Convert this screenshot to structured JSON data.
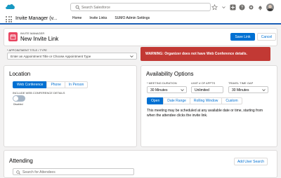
{
  "global": {
    "search_placeholder": "Search Salesforce"
  },
  "nav": {
    "app_name": "Invite Manager (v...",
    "items": [
      {
        "label": "Home"
      },
      {
        "label": "Invite Links"
      },
      {
        "label": "SUMO Admin Settings"
      }
    ]
  },
  "header": {
    "subtitle": "INVITE MANAGER",
    "title": "New Invite Link",
    "save_label": "Save Link",
    "cancel_label": "Cancel"
  },
  "appointment": {
    "label": "* APPOINTMENT TITLE / TYPE",
    "placeholder": "Enter an Appointment Title or Choose Appointment Type"
  },
  "warning": {
    "text": "WARNING: Organizer does not have Web Conference details."
  },
  "location": {
    "title": "Location",
    "tabs": [
      {
        "label": "Web Conference"
      },
      {
        "label": "Phone"
      },
      {
        "label": "In Person"
      }
    ],
    "include_label": "INCLUDE WEB CONFERENCE DETAILS",
    "toggle_state": "Disabled"
  },
  "availability": {
    "title": "Availability Options",
    "meeting_duration_label": "* MEETING DURATION",
    "meeting_duration_value": "30 Minutes",
    "limit_label": "LIMIT # OF APPTS",
    "limit_value": "Unlimited",
    "travel_label": "TRAVEL TIME GAP",
    "travel_value": "30 Minutes",
    "tabs": [
      {
        "label": "Open"
      },
      {
        "label": "Date Range"
      },
      {
        "label": "Rolling Window"
      },
      {
        "label": "Custom"
      }
    ],
    "description": "This meeting may be scheduled at any available date or time, starting from when the attendee clicks the invite link."
  },
  "attending": {
    "title": "Attending",
    "add_user_label": "Add User Search",
    "search_placeholder": "Search for Attendees"
  },
  "colors": {
    "brand": "#0070d2",
    "warning": "#c23934",
    "record_icon": "#e8445f"
  }
}
